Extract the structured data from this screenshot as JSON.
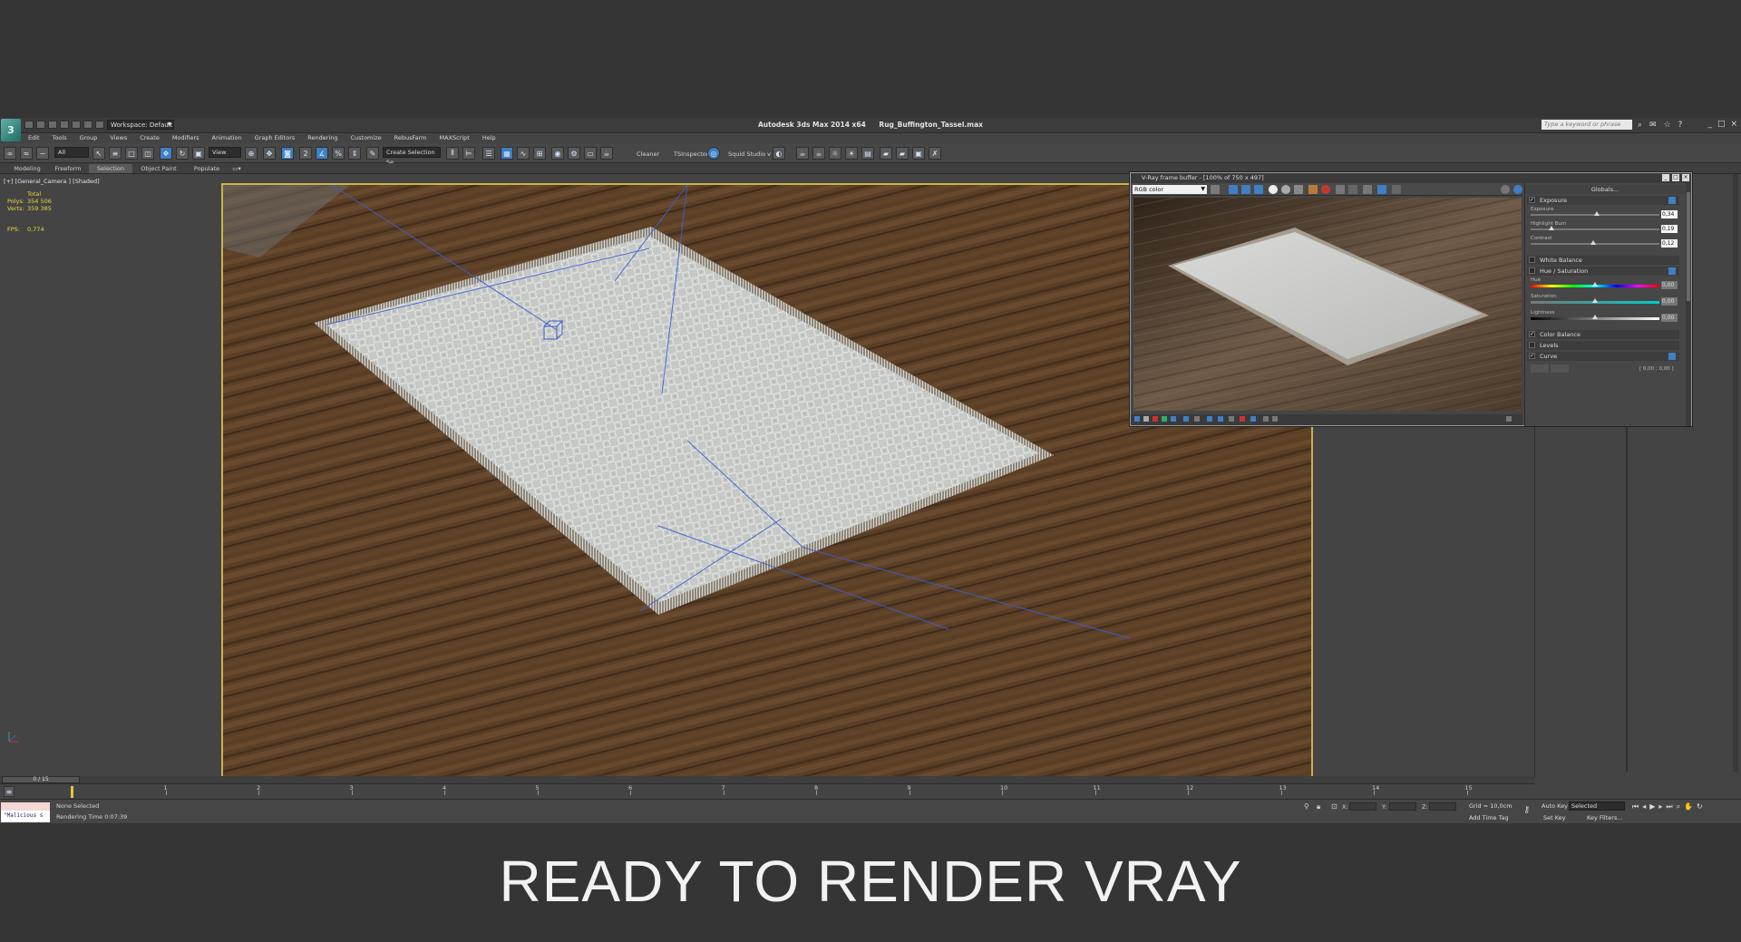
{
  "app": {
    "title": "Autodesk 3ds Max  2014 x64",
    "file": "Rug_Buffington_Tassel.max",
    "workspace": "Workspace: Default",
    "search_placeholder": "Type a keyword or phrase"
  },
  "menu": [
    "Edit",
    "Tools",
    "Group",
    "Views",
    "Create",
    "Modifiers",
    "Animation",
    "Graph Editors",
    "Rendering",
    "Customize",
    "RebusFarm",
    "MAXScript",
    "Help"
  ],
  "toolbar": {
    "filter": "All",
    "view": "View",
    "named_selection": "Create Selection Se",
    "cleaner": "Cleaner",
    "tsinspector": "TSInspector",
    "squid": "Squid Studio v"
  },
  "ribbon_tabs": [
    "Modeling",
    "Freeform",
    "Selection",
    "Object Paint",
    "Populate"
  ],
  "viewport": {
    "label": "[+] [General_Camera ] [Shaded]",
    "stats_total": "Total",
    "polys_label": "Polys:",
    "polys_value": "354 506",
    "verts_label": "Verts:",
    "verts_value": "359 385",
    "fps_label": "FPS:",
    "fps_value": "0,774"
  },
  "vfb": {
    "title": "V-Ray frame buffer - [100% of 750 x 497]",
    "channel": "RGB color",
    "globals": "Globals...",
    "sections": {
      "exposure": "Exposure",
      "white_balance": "White Balance",
      "hue_saturation": "Hue / Saturation",
      "color_balance": "Color Balance",
      "levels": "Levels",
      "curve": "Curve"
    },
    "params": {
      "exposure_label": "Exposure",
      "exposure_value": "0,34",
      "highlight_label": "Highlight Burn",
      "highlight_value": "0,19",
      "contrast_label": "Contrast",
      "contrast_value": "0,12",
      "hue_label": "Hue",
      "hue_value": "0,00",
      "saturation_label": "Saturation",
      "saturation_value": "0,00",
      "lightness_label": "Lightness",
      "lightness_value": "0,00",
      "curve_readout": "[ 0,00 ; 0,00 ]"
    }
  },
  "timeline": {
    "range_label": "0 / 15",
    "ticks": [
      "1",
      "2",
      "3",
      "4",
      "5",
      "6",
      "7",
      "8",
      "9",
      "10",
      "11",
      "12",
      "13",
      "14",
      "15"
    ],
    "current_frame": 0
  },
  "status": {
    "selection": "None Selected",
    "render_time": "Rendering Time  0:07:39",
    "listener": "\"Malicious s",
    "grid": "Grid = 10,0cm",
    "add_time_tag": "Add Time Tag",
    "auto_key": "Auto Key",
    "selected": "Selected",
    "set_key": "Set Key",
    "key_filters": "Key Filters...",
    "x_label": "X:",
    "y_label": "Y:",
    "z_label": "Z:"
  },
  "caption": "READY TO RENDER  VRAY",
  "colors": {
    "viewport_border": "#c9b44b",
    "stats_text": "#e6d83c",
    "wood": "#5d4329",
    "rug": "#c9cbc8"
  }
}
